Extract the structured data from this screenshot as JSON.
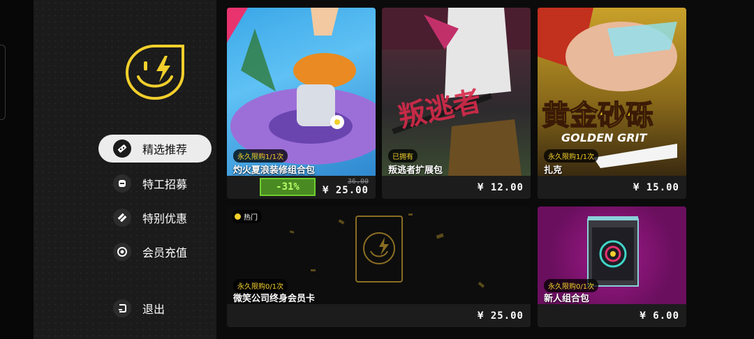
{
  "sidebar": {
    "items": [
      {
        "label": "精选推荐",
        "icon": "featured-icon"
      },
      {
        "label": "特工招募",
        "icon": "agent-icon"
      },
      {
        "label": "特别优惠",
        "icon": "offer-icon"
      },
      {
        "label": "会员充值",
        "icon": "membership-icon"
      },
      {
        "label": "退出",
        "icon": "exit-icon"
      }
    ]
  },
  "cards": [
    {
      "tag": "永久限购1/1次",
      "title": "灼火夏浪装修组合包",
      "discount": "-31%",
      "old_price": "36.00",
      "price": "¥ 25.00"
    },
    {
      "tag": "已拥有",
      "title": "叛逃者扩展包",
      "price": "¥ 12.00",
      "art_text": "叛逃者"
    },
    {
      "tag": "永久限购1/1次",
      "title": "扎克",
      "price": "¥ 15.00",
      "art_text": "黄金砂砾",
      "art_subtext": "GOLDEN GRIT"
    },
    {
      "hot": "热门",
      "tag": "永久限购0/1次",
      "title": "微笑公司终身会员卡",
      "price": "¥ 25.00"
    },
    {
      "tag": "永久限购0/1次",
      "title": "新人组合包",
      "price": "¥ 6.00"
    }
  ],
  "colors": {
    "accent_yellow": "#f2cf2c",
    "discount_green": "#6fcf2e"
  }
}
